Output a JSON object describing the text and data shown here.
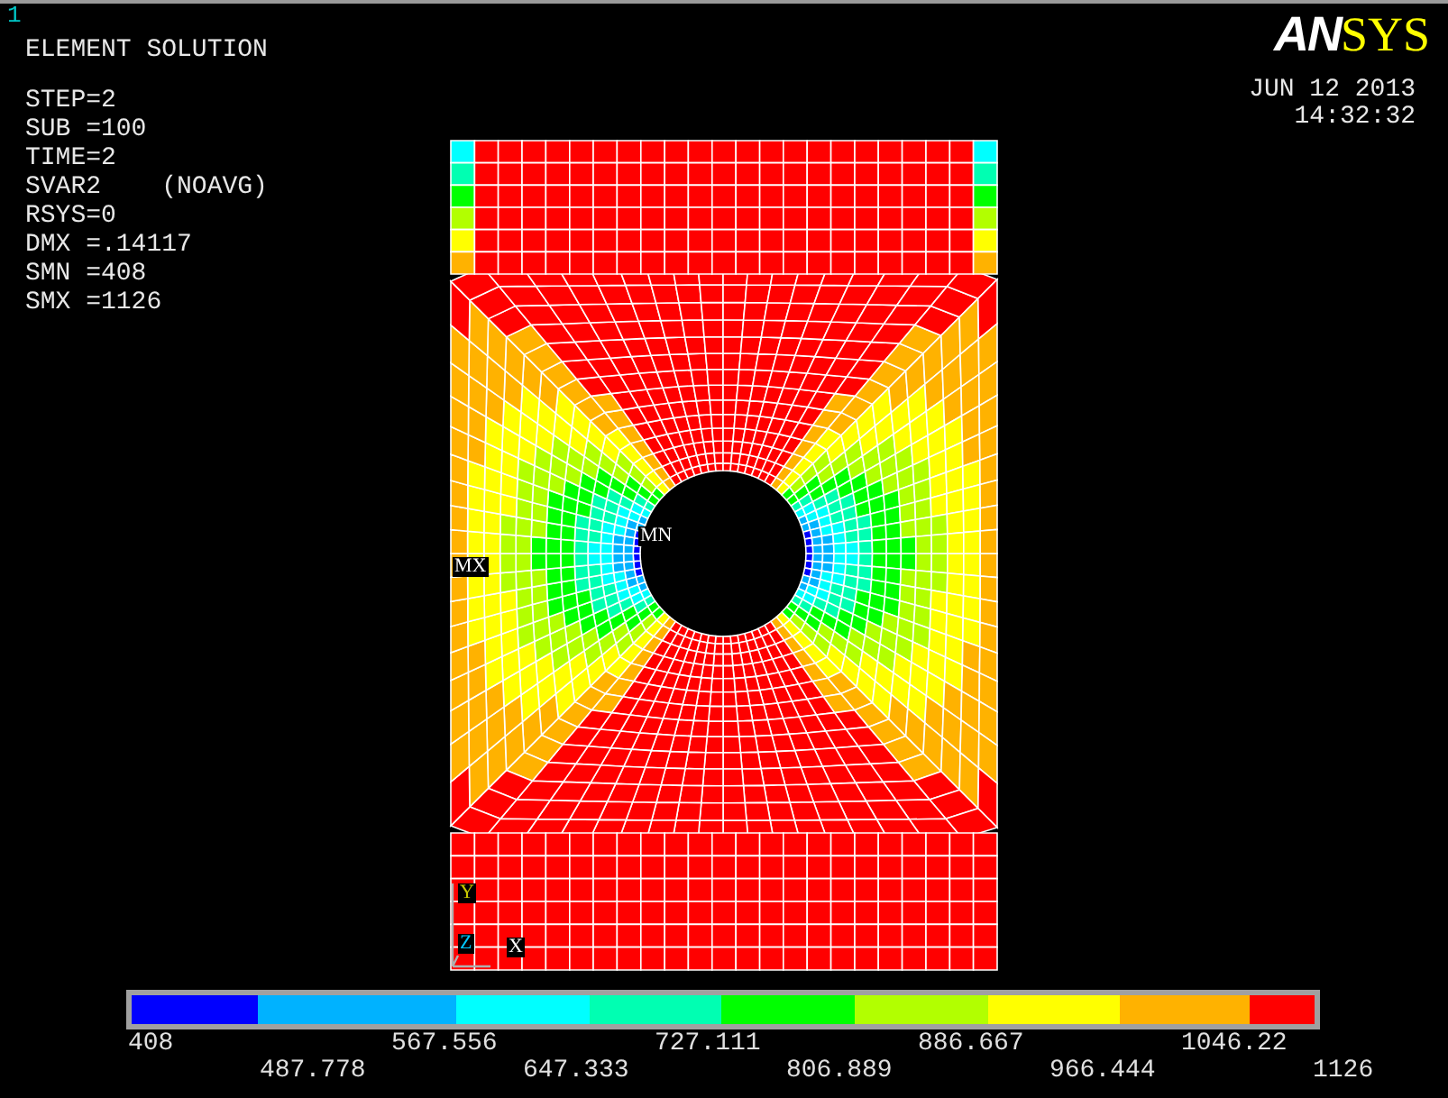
{
  "window_number": "1",
  "title": "ELEMENT SOLUTION",
  "info": [
    "STEP=2",
    "SUB =100",
    "TIME=2",
    "SVAR2    (NOAVG)",
    "RSYS=0",
    "DMX =.14117",
    "SMN =408",
    "SMX =1126"
  ],
  "logo": {
    "lead": "AN",
    "rest": "SYS"
  },
  "date": "JUN 12 2013",
  "time": "14:32:32",
  "plot": {
    "min_marker": "MN",
    "max_marker": "MX",
    "axes": [
      {
        "label": "Y"
      },
      {
        "label": "Z"
      },
      {
        "label": "X"
      }
    ]
  },
  "legend": {
    "bands": [
      {
        "color": "#0000ff"
      },
      {
        "color": "#00b2ff"
      },
      {
        "color": "#00ffff"
      },
      {
        "color": "#00ffb2"
      },
      {
        "color": "#00ff00"
      },
      {
        "color": "#b2ff00"
      },
      {
        "color": "#ffff00"
      },
      {
        "color": "#ffb200"
      },
      {
        "color": "#ff0000"
      }
    ],
    "labels": [
      "408",
      "487.778",
      "567.556",
      "647.333",
      "727.111",
      "806.889",
      "886.667",
      "966.444",
      "1046.22",
      "1126"
    ]
  }
}
